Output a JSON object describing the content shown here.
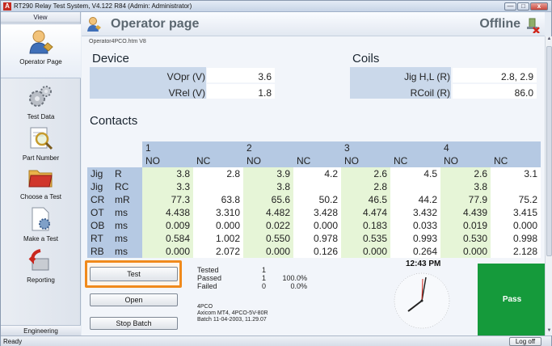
{
  "window": {
    "title": "RT290 Relay Test System, V4.122 R84 (Admin: Administrator)",
    "app_icon": "A",
    "min": "—",
    "max": "□",
    "close": "x"
  },
  "sidebar": {
    "header": "View",
    "items": [
      {
        "label": "Operator Page",
        "icon": "operator-icon"
      },
      {
        "label": "Test Data",
        "icon": "gears-icon"
      },
      {
        "label": "Part Number",
        "icon": "magnifier-icon"
      },
      {
        "label": "Choose a Test",
        "icon": "folder-icon"
      },
      {
        "label": "Make a Test",
        "icon": "document-gear-icon"
      },
      {
        "label": "Reporting",
        "icon": "arrow-icon"
      }
    ],
    "footer": "Engineering"
  },
  "header": {
    "title": "Operator page",
    "status": "Offline",
    "file": "Operator4PCO.htm V8"
  },
  "device": {
    "section": "Device",
    "rows": [
      {
        "label": "VOpr (V)",
        "value": "3.6"
      },
      {
        "label": "VRel (V)",
        "value": "1.8"
      }
    ]
  },
  "coils": {
    "section": "Coils",
    "rows": [
      {
        "label": "Jig H,L (R)",
        "value": "2.8, 2.9"
      },
      {
        "label": "RCoil (R)",
        "value": "86.0"
      }
    ]
  },
  "contacts": {
    "section": "Contacts",
    "groups": [
      "1",
      "2",
      "3",
      "4"
    ],
    "subheaders": [
      "NO",
      "NC",
      "NO",
      "NC",
      "NO",
      "NC",
      "NO",
      "NC"
    ],
    "rows": [
      {
        "name": "Jig",
        "unit": "R",
        "values": [
          "3.8",
          "2.8",
          "3.9",
          "4.2",
          "2.6",
          "4.5",
          "2.6",
          "3.1"
        ]
      },
      {
        "name": "Jig",
        "unit": "RC",
        "values": [
          "3.3",
          "",
          "3.8",
          "",
          "2.8",
          "",
          "3.8",
          ""
        ]
      },
      {
        "name": "CR",
        "unit": "mR",
        "values": [
          "77.3",
          "63.8",
          "65.6",
          "50.2",
          "46.5",
          "44.2",
          "77.9",
          "75.2"
        ]
      },
      {
        "name": "OT",
        "unit": "ms",
        "values": [
          "4.438",
          "3.310",
          "4.482",
          "3.428",
          "4.474",
          "3.432",
          "4.439",
          "3.415"
        ]
      },
      {
        "name": "OB",
        "unit": "ms",
        "values": [
          "0.009",
          "0.000",
          "0.022",
          "0.000",
          "0.183",
          "0.033",
          "0.019",
          "0.000"
        ]
      },
      {
        "name": "RT",
        "unit": "ms",
        "values": [
          "0.584",
          "1.002",
          "0.550",
          "0.978",
          "0.535",
          "0.993",
          "0.530",
          "0.998"
        ]
      },
      {
        "name": "RB",
        "unit": "ms",
        "values": [
          "0.000",
          "2.072",
          "0.000",
          "0.126",
          "0.000",
          "0.264",
          "0.000",
          "2.128"
        ]
      }
    ]
  },
  "buttons": {
    "test": "Test",
    "open": "Open",
    "stop_batch": "Stop Batch"
  },
  "stats": {
    "tested_label": "Tested",
    "tested_count": "1",
    "tested_pct": "",
    "passed_label": "Passed",
    "passed_count": "1",
    "passed_pct": "100.0%",
    "failed_label": "Failed",
    "failed_count": "0",
    "failed_pct": "0.0%"
  },
  "info": {
    "line1": "4PCO",
    "line2": "Axicom MT4, 4PCO-5V-80R",
    "line3": "Batch 11-04-2003, 11.29.07"
  },
  "clock": {
    "time": "12:43 PM"
  },
  "result": {
    "label": "Pass",
    "color": "#159a3b"
  },
  "statusbar": {
    "text": "Ready",
    "logoff": "Log off"
  },
  "colors": {
    "accent_orange": "#f08a1c",
    "header_blue": "#b5c9e3",
    "value_green": "#e6f5d7"
  }
}
